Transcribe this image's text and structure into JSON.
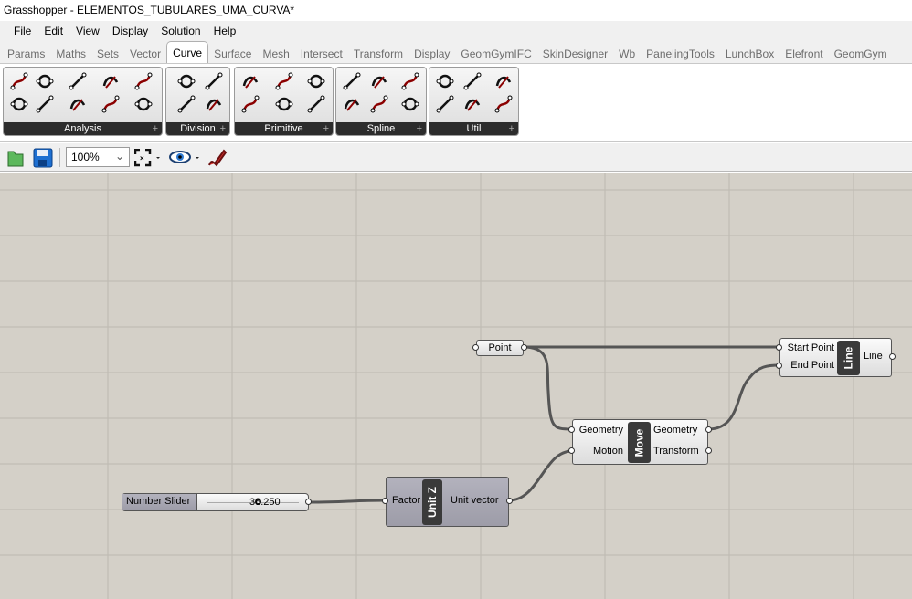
{
  "window": {
    "title": "Grasshopper - ELEMENTOS_TUBULARES_UMA_CURVA*"
  },
  "menu": [
    "File",
    "Edit",
    "View",
    "Display",
    "Solution",
    "Help"
  ],
  "tabs": [
    {
      "label": "Params"
    },
    {
      "label": "Maths"
    },
    {
      "label": "Sets"
    },
    {
      "label": "Vector"
    },
    {
      "label": "Curve",
      "active": true
    },
    {
      "label": "Surface"
    },
    {
      "label": "Mesh"
    },
    {
      "label": "Intersect"
    },
    {
      "label": "Transform"
    },
    {
      "label": "Display"
    },
    {
      "label": "GeomGymIFC"
    },
    {
      "label": "SkinDesigner"
    },
    {
      "label": "Wb"
    },
    {
      "label": "PanelingTools"
    },
    {
      "label": "LunchBox"
    },
    {
      "label": "Elefront"
    },
    {
      "label": "GeomGym"
    }
  ],
  "ribbon": {
    "groups": [
      "Analysis",
      "Division",
      "Primitive",
      "Spline",
      "Util"
    ],
    "accent": "#8b0000"
  },
  "toolbar": {
    "zoom": "100%",
    "icons": [
      "open-file-icon",
      "save-icon",
      "zoom-extents-icon",
      "preview-eye-icon",
      "sketch-pen-icon"
    ]
  },
  "canvas": {
    "point": {
      "label": "Point"
    },
    "line": {
      "nickname": "Line",
      "inputs": [
        "Start Point",
        "End Point"
      ],
      "outputs": [
        "Line"
      ]
    },
    "move": {
      "nickname": "Move",
      "inputs": [
        "Geometry",
        "Motion"
      ],
      "outputs": [
        "Geometry",
        "Transform"
      ]
    },
    "unitz": {
      "nickname": "Unit Z",
      "inputs": [
        "Factor"
      ],
      "outputs": [
        "Unit vector"
      ]
    },
    "slider": {
      "label": "Number Slider",
      "value": "38.250",
      "fraction": 0.55
    }
  }
}
